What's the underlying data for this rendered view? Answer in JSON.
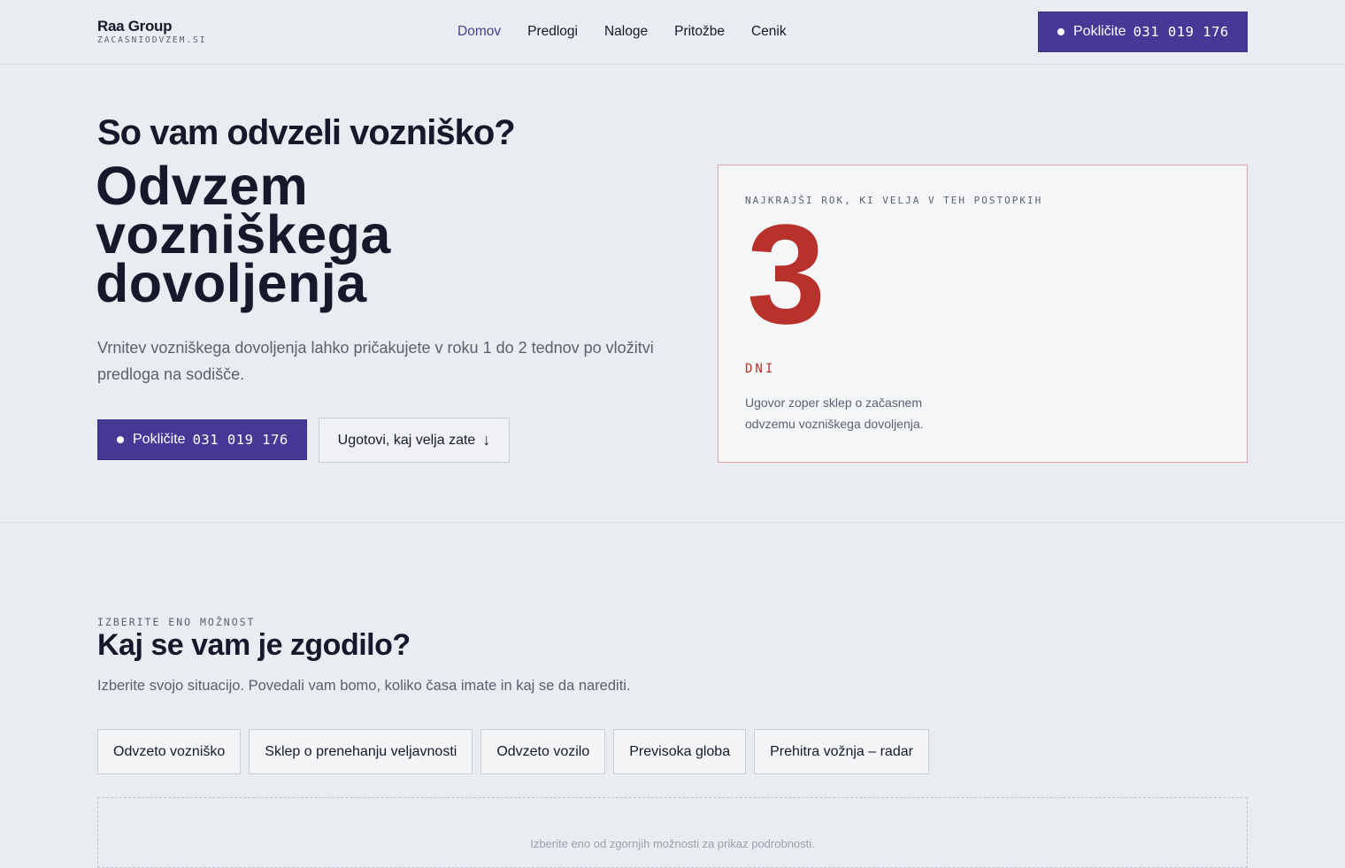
{
  "header": {
    "brand_name": "Raa Group",
    "brand_domain": "ZACASNIODVZEM.SI",
    "nav": [
      {
        "label": "Domov",
        "active": true
      },
      {
        "label": "Predlogi",
        "active": false
      },
      {
        "label": "Naloge",
        "active": false
      },
      {
        "label": "Pritožbe",
        "active": false
      },
      {
        "label": "Cenik",
        "active": false
      }
    ],
    "cta_label": "Pokličite",
    "cta_number": "031 019 176"
  },
  "hero": {
    "question": "So vam odvzeli vozniško?",
    "title_lines": [
      "Odvzem",
      "vozniškega",
      "dovoljenja"
    ],
    "subtitle": "Vrnitev vozniškega dovoljenja lahko pričakujete v roku 1 do 2 tednov po vložitvi predloga na sodišče.",
    "call_label": "Pokličite",
    "call_number": "031 019 176",
    "secondary_label": "Ugotovi, kaj velja zate",
    "secondary_arrow": "↓"
  },
  "deadline": {
    "label": "NAJKRAJŠI ROK, KI VELJA V TEH POSTOPKIH",
    "number": "3",
    "unit": "DNI",
    "note": "Ugovor zoper sklep o začasnem odvzemu vozniškega dovoljenja."
  },
  "situations": {
    "eyebrow": "IZBERITE ENO MOŽNOST",
    "title": "Kaj se vam je zgodilo?",
    "subtitle": "Izberite svojo situacijo. Povedali vam bomo, koliko časa imate in kaj se da narediti.",
    "options": [
      "Odvzeto vozniško",
      "Sklep o prenehanju veljavnosti",
      "Odvzeto vozilo",
      "Previsoka globa",
      "Prehitra vožnja – radar"
    ],
    "result_hint": "Izberite eno od zgornjih možnosti za prikaz podrobnosti."
  },
  "colors": {
    "primary": "#463995",
    "accent_red": "#b8312a",
    "background": "#e9ecf0"
  }
}
